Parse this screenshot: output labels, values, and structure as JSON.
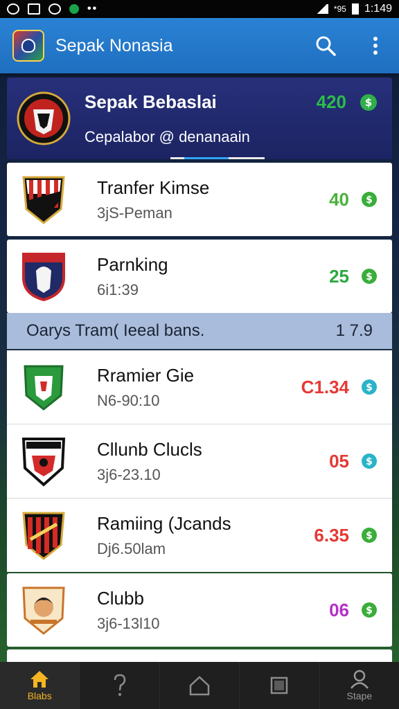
{
  "status_bar": {
    "time": "1:149",
    "indicator": "*95"
  },
  "app_bar": {
    "title": "Sepak Nonasia",
    "icons": [
      "search-icon",
      "more-vert-icon"
    ]
  },
  "featured": {
    "title": "Sepak Bebaslai",
    "subtitle": "Cepalabor @ denanaain",
    "value": "420",
    "value_color": "#2dbd4a"
  },
  "rows_top": [
    {
      "title": "Tranfer Kimse",
      "subtitle": "3jS-Peman",
      "value": "40",
      "value_color": "#49b33b",
      "badge_color": "#3aad3a"
    },
    {
      "title": "Parnking",
      "subtitle": "6i1:39",
      "value": "25",
      "value_color": "#2ea840",
      "badge_color": "#3aad3a"
    }
  ],
  "section": {
    "left": "Oarys  Tram( Ieeal bans.",
    "right": "1 7.9"
  },
  "rows_bottom": [
    {
      "title": "Rramier Gie",
      "subtitle": "N6-90:10",
      "value": "C1.34",
      "value_color": "#e53935",
      "badge_color": "#2ab3c9"
    },
    {
      "title": "Cllunb Clucls",
      "subtitle": "3j6-23.10",
      "value": "05",
      "value_color": "#e53935",
      "badge_color": "#2ab3c9"
    },
    {
      "title": "Ramiing (Jcands",
      "subtitle": "Dj6.50lam",
      "value": "6.35",
      "value_color": "#e53935",
      "badge_color": "#3aad3a"
    },
    {
      "title": "Clubb",
      "subtitle": "3j6-13l10",
      "value": "06",
      "value_color": "#b52fc7",
      "badge_color": "#3aad3a"
    }
  ],
  "bottom_nav": [
    {
      "label": "Blabs",
      "icon": "home-icon",
      "active": true
    },
    {
      "label": "",
      "icon": "help-icon",
      "active": false
    },
    {
      "label": "",
      "icon": "house-outline-icon",
      "active": false
    },
    {
      "label": "",
      "icon": "square-icon",
      "active": false
    },
    {
      "label": "Stape",
      "icon": "person-icon",
      "active": false
    }
  ]
}
